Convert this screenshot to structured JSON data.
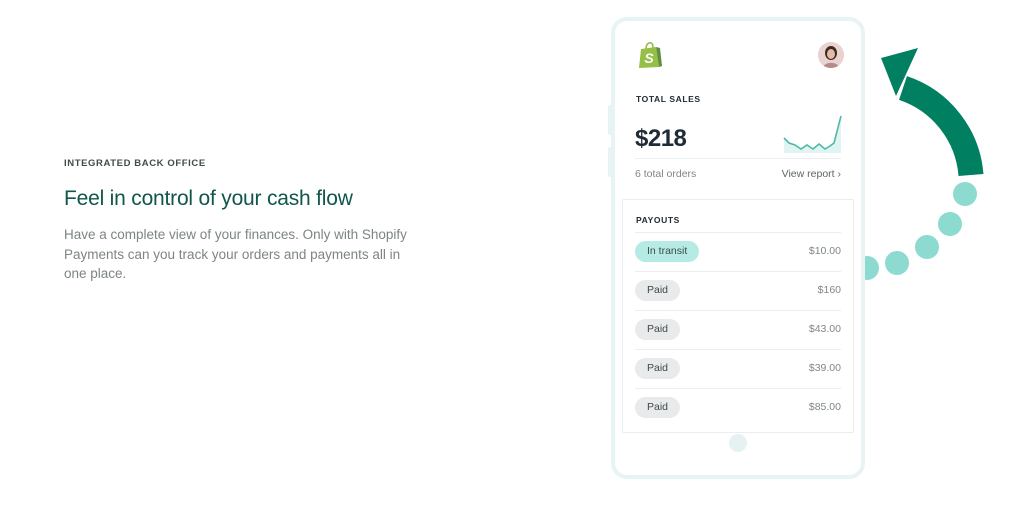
{
  "section": {
    "eyebrow": "INTEGRATED BACK OFFICE",
    "headline": "Feel in control of your cash flow",
    "body": "Have a complete view of your finances. Only with Shopify Payments can you track your orders and payments all in one place."
  },
  "phone": {
    "logo_icon": "shopify-bag-icon",
    "avatar_icon": "user-avatar",
    "total_sales": {
      "label": "TOTAL SALES",
      "value": "$218",
      "orders": "6 total orders",
      "view_report": "View report",
      "view_report_icon": "chevron-right-icon"
    },
    "payouts": {
      "label": "PAYOUTS",
      "rows": [
        {
          "status": "In transit",
          "amount": "$10.00"
        },
        {
          "status": "Paid",
          "amount": "$160"
        },
        {
          "status": "Paid",
          "amount": "$43.00"
        },
        {
          "status": "Paid",
          "amount": "$39.00"
        },
        {
          "status": "Paid",
          "amount": "$85.00"
        }
      ]
    }
  },
  "colors": {
    "headline": "#10564a",
    "arrow": "#008060",
    "dots": "#8cdad0",
    "transit_pill": "#b5ebe4",
    "paid_pill": "#e8eaeb",
    "logo": "#95bf47"
  }
}
